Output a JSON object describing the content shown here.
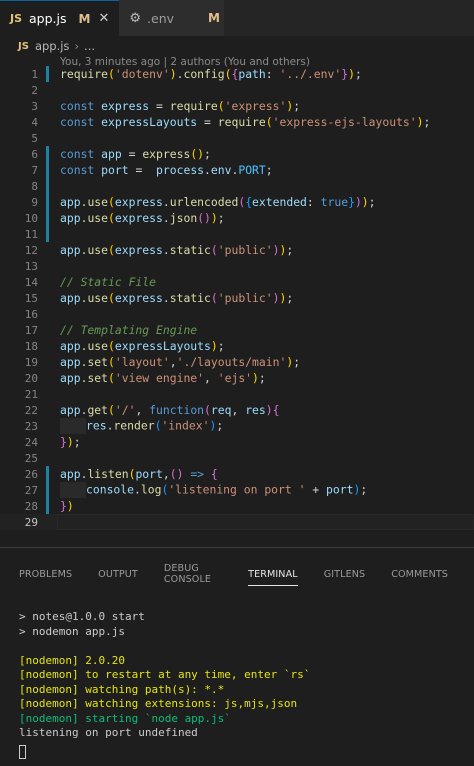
{
  "tabs": [
    {
      "badge": "JS",
      "label": "app.js",
      "status": "M",
      "close": "✕"
    },
    {
      "label": ".env",
      "status": "M"
    }
  ],
  "breadcrumb": {
    "badge": "JS",
    "file": "app.js",
    "ellipsis": "..."
  },
  "editor": {
    "blame": "You, 3 minutes ago | 2 authors (You and others)",
    "line_numbers": [
      "1",
      "2",
      "3",
      "4",
      "5",
      "6",
      "7",
      "8",
      "9",
      "10",
      "11",
      "12",
      "13",
      "14",
      "15",
      "16",
      "17",
      "18",
      "19",
      "20",
      "21",
      "22",
      "23",
      "24",
      "25",
      "26",
      "27",
      "28",
      "29"
    ]
  },
  "panel": {
    "tabs": [
      "PROBLEMS",
      "OUTPUT",
      "DEBUG CONSOLE",
      "TERMINAL",
      "GITLENS",
      "COMMENTS"
    ],
    "active_tab": "TERMINAL"
  },
  "terminal": {
    "lines": [
      "> notes@1.0.0 start",
      "> nodemon app.js",
      "",
      "[nodemon] 2.0.20",
      "[nodemon] to restart at any time, enter `rs`",
      "[nodemon] watching path(s): *.*",
      "[nodemon] watching extensions: js,mjs,json",
      "[nodemon] starting `node app.js`",
      "listening on port undefined"
    ]
  },
  "colors": {
    "keyword": "#569cd6",
    "function": "#dcdcaa",
    "string": "#ce9178",
    "comment": "#6a9955",
    "terminal_yellow": "#e5e510",
    "terminal_green": "#0dbc79",
    "git_modified": "#1b81a8"
  }
}
